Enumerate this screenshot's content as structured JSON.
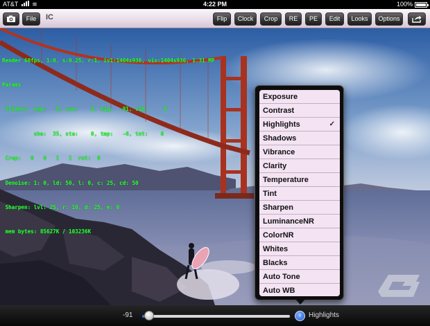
{
  "status_bar": {
    "carrier": "AT&T",
    "time": "4:22 PM",
    "battery_percent": "100%"
  },
  "toolbar": {
    "title": "IC",
    "file_label": "File",
    "buttons": [
      "Flip",
      "Clock",
      "Crop",
      "RE",
      "PE",
      "Edit",
      "Looks",
      "Options"
    ],
    "camera_icon": "camera-icon",
    "share_icon": "share-icon"
  },
  "overlay": {
    "lines": [
      "Render 60fps, 1:0, s:0.25, r:1, iv1:1404x936, vis:1404x936, 1.31 MP",
      "Params",
      " Sliders  exp:   0, con:    0, hig:  -91, vib:     0",
      "          sha:  35, sta:    0, tmp:   -6, tnt:    8",
      " Crop:   0   0   1   1  rot:  0",
      " Denoise: 1: 0, ld: 50, l: 0, c: 25, cd: 50",
      " Sharpen: lvl: 25, r: 10, d: 25, e: 0",
      " mem bytes: 85627K / 103236K"
    ]
  },
  "menu": {
    "items": [
      {
        "label": "Exposure",
        "checked": false
      },
      {
        "label": "Contrast",
        "checked": false
      },
      {
        "label": "Highlights",
        "checked": true
      },
      {
        "label": "Shadows",
        "checked": false
      },
      {
        "label": "Vibrance",
        "checked": false
      },
      {
        "label": "Clarity",
        "checked": false
      },
      {
        "label": "Temperature",
        "checked": false
      },
      {
        "label": "Tint",
        "checked": false
      },
      {
        "label": "Sharpen",
        "checked": false
      },
      {
        "label": "LuminanceNR",
        "checked": false
      },
      {
        "label": "ColorNR",
        "checked": false
      },
      {
        "label": "Whites",
        "checked": false
      },
      {
        "label": "Blacks",
        "checked": false
      },
      {
        "label": "Auto Tone",
        "checked": false
      },
      {
        "label": "Auto WB",
        "checked": false
      }
    ],
    "check_mark": "✓"
  },
  "bottom_bar": {
    "slider_value": "-91",
    "slider_fraction": 0.045,
    "selected_adjustment": "Highlights",
    "info_icon": "info-icon"
  },
  "colors": {
    "overlay_text": "#2dff2d",
    "slider_fill": "#2f6fd6",
    "menu_background": "#f3e3f3"
  }
}
